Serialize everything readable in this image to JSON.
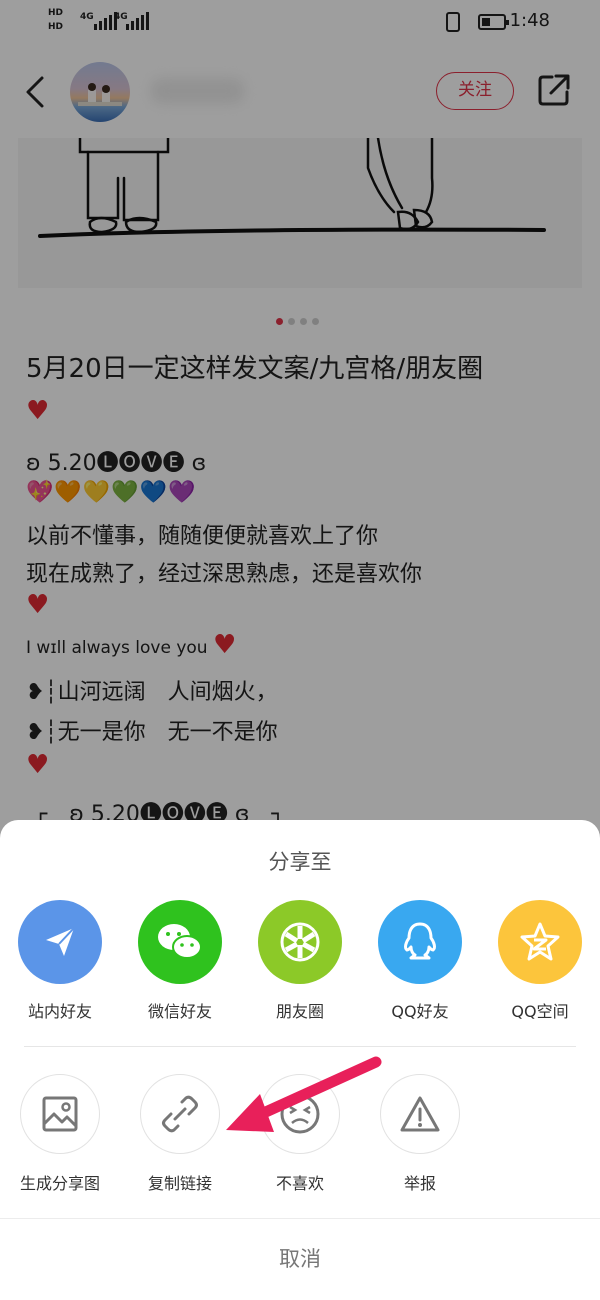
{
  "status_bar": {
    "sim1": "HD",
    "sim2": "HD",
    "net1": "4G",
    "net2": "4G",
    "time": "1:48"
  },
  "header": {
    "follow_label": "关注"
  },
  "post": {
    "title": "5月20日一定这样发文案/九宫格/朋友圈",
    "heart": "♥",
    "line_love_1": "ʚ 5.20🅛🅞🅥🅔 ɞ",
    "hearts_row": [
      "💖",
      "🧡",
      "💛",
      "💚",
      "💙",
      "💜"
    ],
    "line_1": "以前不懂事，随随便便就喜欢上了你",
    "line_2": "现在成熟了，经过深思熟虑，还是喜欢你",
    "line_3": "I wɪll always love you",
    "line_4": "❥┆山河远阔　人间烟火，",
    "line_5": "❥┆无一是你　无一不是你",
    "line_6": "┌　ʚ 5.20🅛🅞🅥🅔 ɞ　┐"
  },
  "carousel": {
    "page": 1,
    "total": 4
  },
  "share_sheet": {
    "title": "分享至",
    "targets": [
      {
        "label": "站内好友",
        "icon": "paper-plane-icon",
        "color": "#5b95e8"
      },
      {
        "label": "微信好友",
        "icon": "wechat-icon",
        "color": "#2fc21e"
      },
      {
        "label": "朋友圈",
        "icon": "moments-icon",
        "color": "#8cc928"
      },
      {
        "label": "QQ好友",
        "icon": "qq-icon",
        "color": "#39a8f0"
      },
      {
        "label": "QQ空间",
        "icon": "qzone-icon",
        "color": "#fcc53c"
      }
    ],
    "actions": [
      {
        "label": "生成分享图",
        "icon": "image-icon"
      },
      {
        "label": "复制链接",
        "icon": "link-icon"
      },
      {
        "label": "不喜欢",
        "icon": "dislike-face-icon"
      },
      {
        "label": "举报",
        "icon": "warning-icon"
      }
    ],
    "cancel_label": "取消"
  },
  "annotation": {
    "color": "#e8205a"
  }
}
